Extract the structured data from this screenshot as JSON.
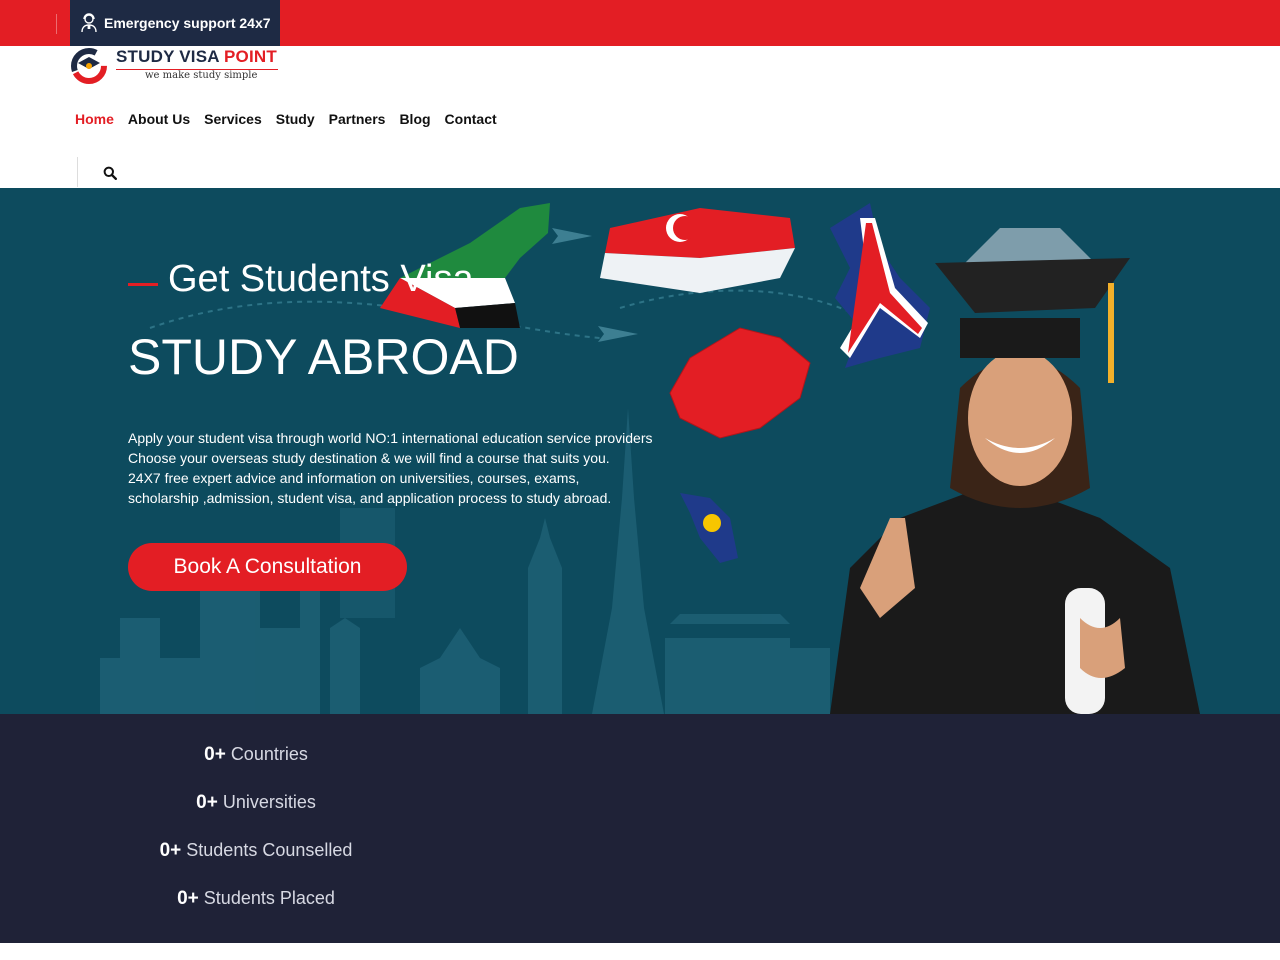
{
  "topbar": {
    "support_label": "Emergency support 24x7"
  },
  "logo": {
    "brand_primary": "STUDY VISA ",
    "brand_accent": "POINT",
    "tagline": "we make study simple"
  },
  "nav": {
    "items": [
      {
        "label": "Home",
        "active": true
      },
      {
        "label": "About Us"
      },
      {
        "label": "Services"
      },
      {
        "label": "Study"
      },
      {
        "label": "Partners"
      },
      {
        "label": "Blog"
      },
      {
        "label": "Contact"
      }
    ]
  },
  "hero": {
    "eyebrow": "Get Students Visa",
    "headline": "STUDY ABROAD",
    "description": [
      "Apply your student visa through world NO:1 international education service providers",
      "Choose your overseas study destination & we will find a course that suits you.",
      "24X7 free expert advice and information on universities, courses, exams,",
      "scholarship ,admission, student visa, and application process to study abroad."
    ],
    "cta_label": "Book A Consultation"
  },
  "stats": [
    {
      "value": "0+",
      "label": "Countries"
    },
    {
      "value": "0+",
      "label": "Universities"
    },
    {
      "value": "0+",
      "label": "Students Counselled"
    },
    {
      "value": "0+",
      "label": "Students Placed"
    }
  ],
  "icons": {
    "support": "headset-agent-icon",
    "search": "search-icon"
  },
  "colors": {
    "brand_red": "#e31e24",
    "navy": "#1e2a44",
    "hero_teal": "#0d4b5e",
    "stats_bg": "#1f2237"
  }
}
